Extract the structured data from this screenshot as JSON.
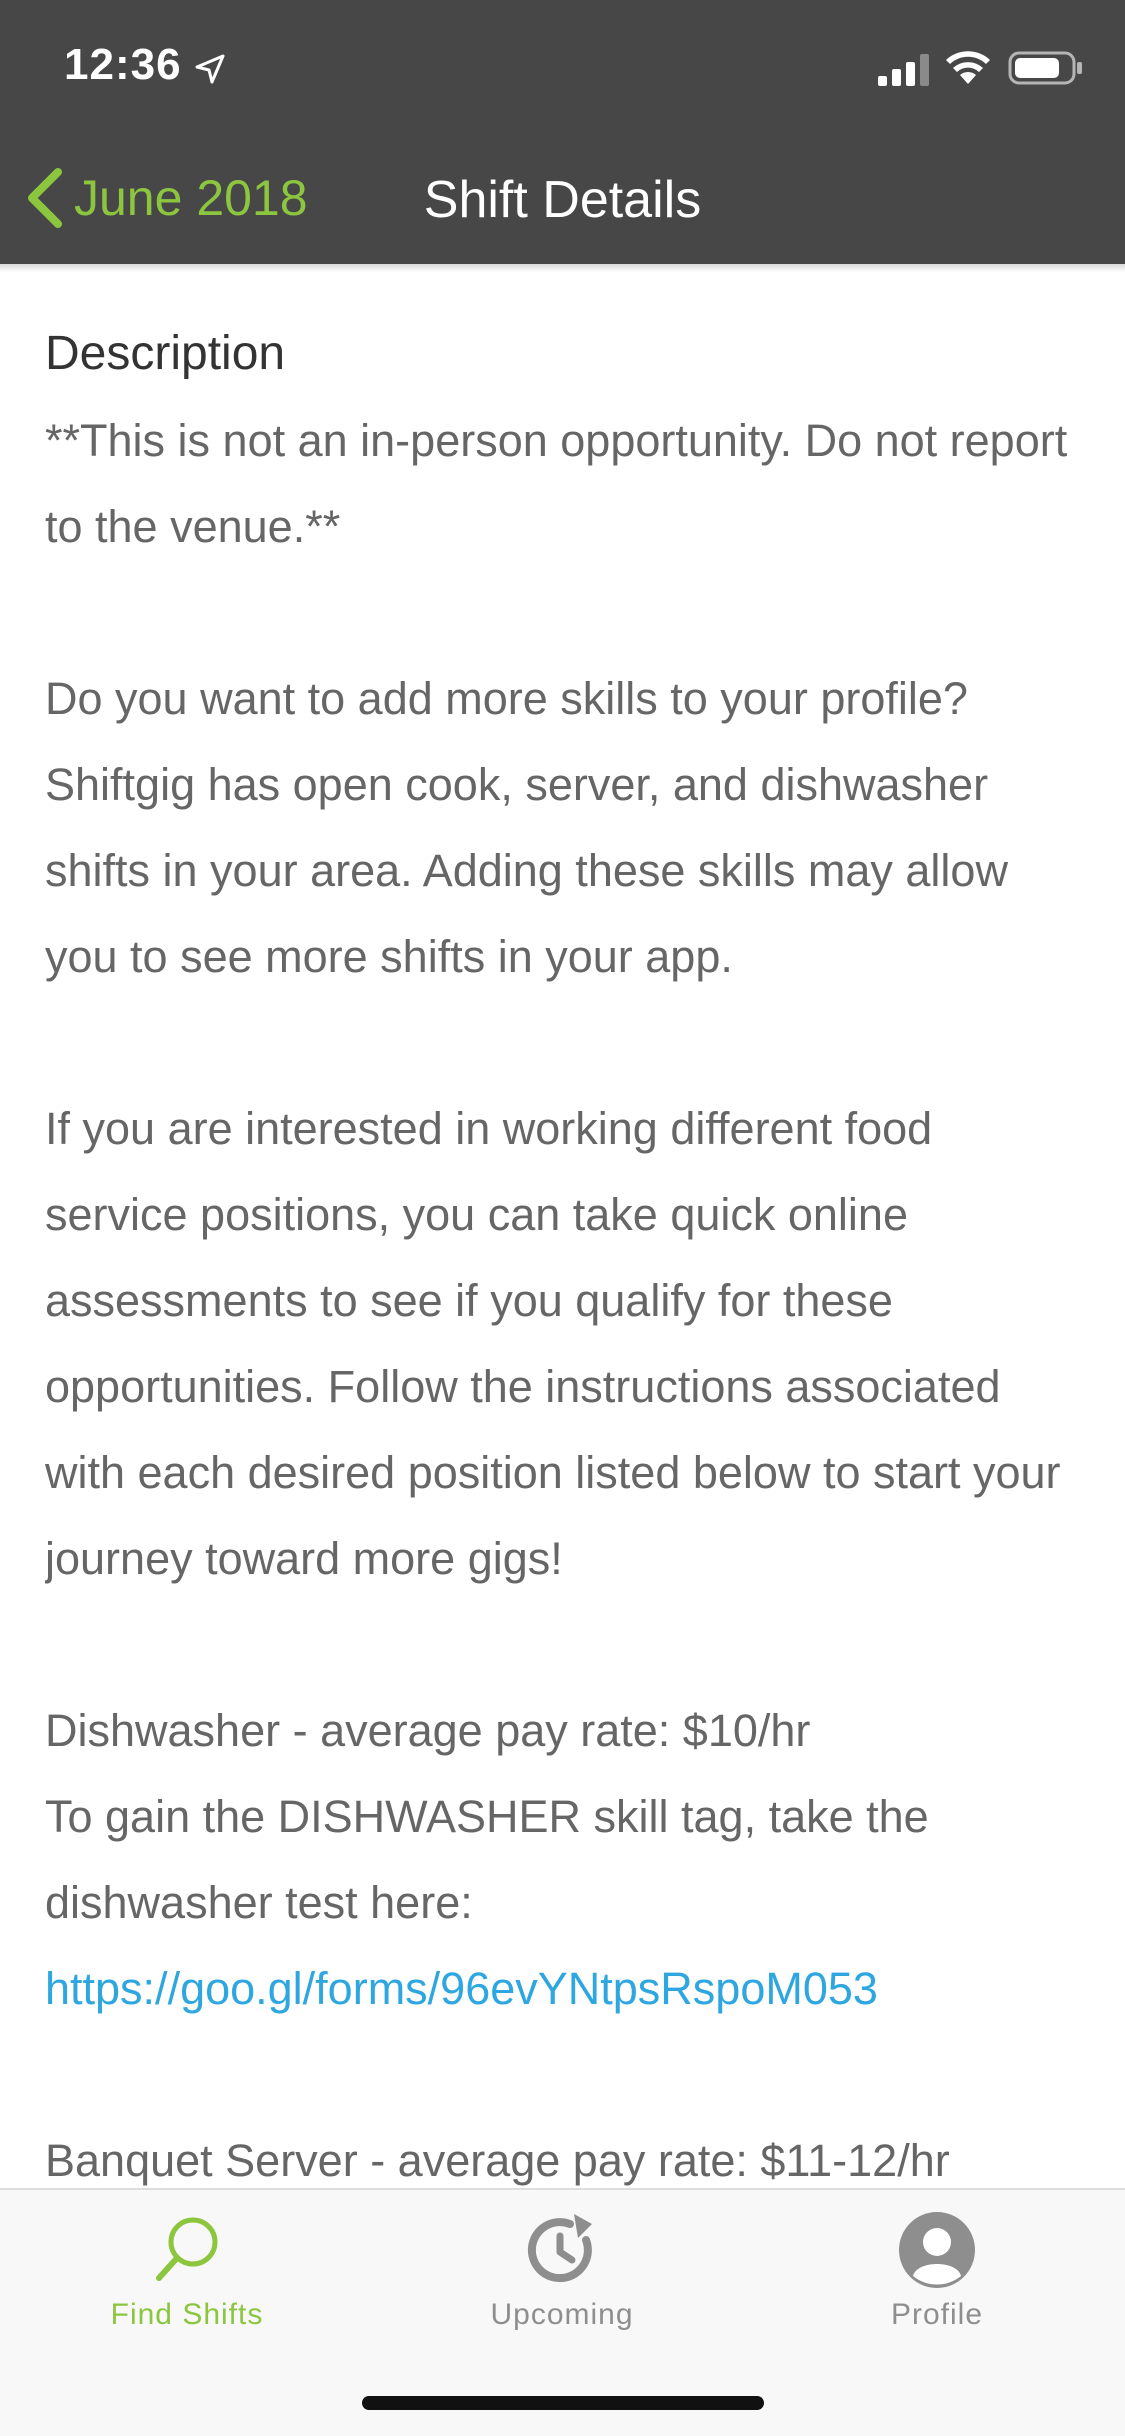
{
  "status_bar": {
    "time": "12:36",
    "icons": [
      "location-arrow-icon",
      "signal-icon",
      "wifi-icon",
      "battery-icon"
    ]
  },
  "nav": {
    "back_label": "June 2018",
    "title": "Shift Details"
  },
  "content": {
    "section_title": "Description",
    "paragraphs": [
      "**This is not an in-person opportunity. Do not report to the venue.**",
      "Do you want to add more skills to your profile? Shiftgig has open cook, server, and dishwasher shifts in your area. Adding these skills may allow you to see more shifts in your app.",
      "If you are interested in working different food service positions, you can take quick online assessments to see if you qualify for these opportunities. Follow the instructions associated with each desired position listed below to start your journey toward more gigs!"
    ],
    "dishwasher": {
      "pay_line": "Dishwasher - average pay rate: $10/hr",
      "instruction": "To gain the DISHWASHER skill tag, take the dishwasher test here: ",
      "link": "https://goo.gl/forms/96evYNtpsRspoM053"
    },
    "banquet": {
      "pay_line": "Banquet Server - average pay rate: $11-12/hr"
    }
  },
  "tabbar": {
    "tabs": [
      {
        "label": "Find Shifts",
        "icon": "search-icon",
        "active": true
      },
      {
        "label": "Upcoming",
        "icon": "clock-history-icon",
        "active": false
      },
      {
        "label": "Profile",
        "icon": "profile-icon",
        "active": false
      }
    ]
  },
  "colors": {
    "header_bg": "#474747",
    "accent_green": "#8cc63f",
    "link_blue": "#2ea7e0",
    "body_text": "#666666",
    "inactive_tab": "#8e8e8e"
  }
}
